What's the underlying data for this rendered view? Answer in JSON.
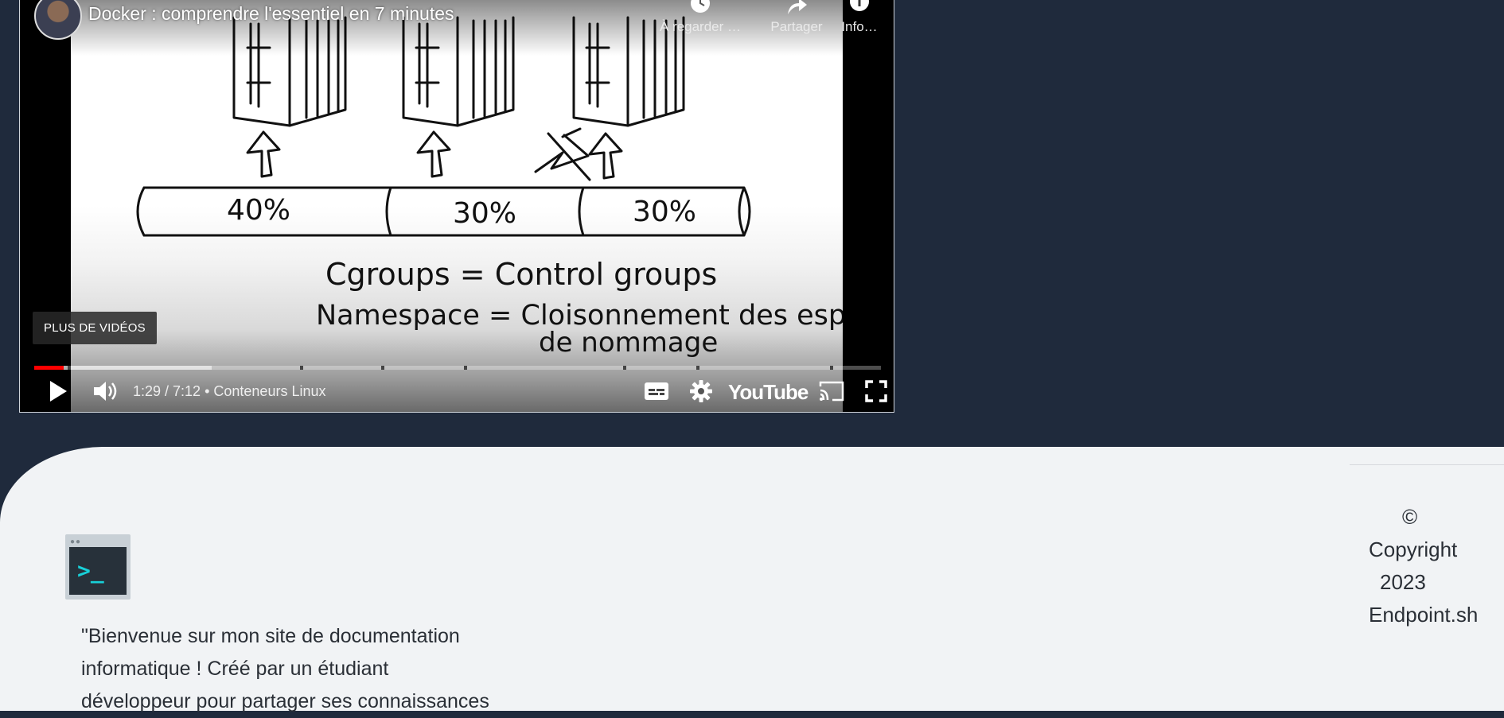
{
  "player": {
    "title": "Docker : comprendre l'essentiel en 7 minutes",
    "actions": [
      {
        "label": "À regarder …",
        "icon": "clock-icon"
      },
      {
        "label": "Partager",
        "icon": "share-icon"
      },
      {
        "label": "Info…",
        "icon": "info-icon"
      }
    ],
    "more_videos": "PLUS DE VIDÉOS",
    "time": "1:29 / 7:12",
    "separator": "•",
    "chapter": "Conteneurs Linux",
    "progress_played": 0.035,
    "progress_loaded": 0.21,
    "youtube_logo": "YouTube",
    "frame": {
      "bar_labels": [
        "40%",
        "30%",
        "30%"
      ],
      "line1": "Cgroups = Control groups",
      "line2": "Namespace = Cloisonnement des espaces",
      "line3": "de nommage"
    }
  },
  "footer": {
    "bio_lines": [
      "\"Bienvenue sur mon site de documentation",
      "informatique ! Créé par un étudiant",
      "développeur pour partager ses connaissances"
    ],
    "logo_prompt": ">_",
    "copyright_symbol": "©",
    "copyright_word": "Copyright",
    "copyright_year": "2023",
    "copyright_site": "Endpoint.sh"
  }
}
